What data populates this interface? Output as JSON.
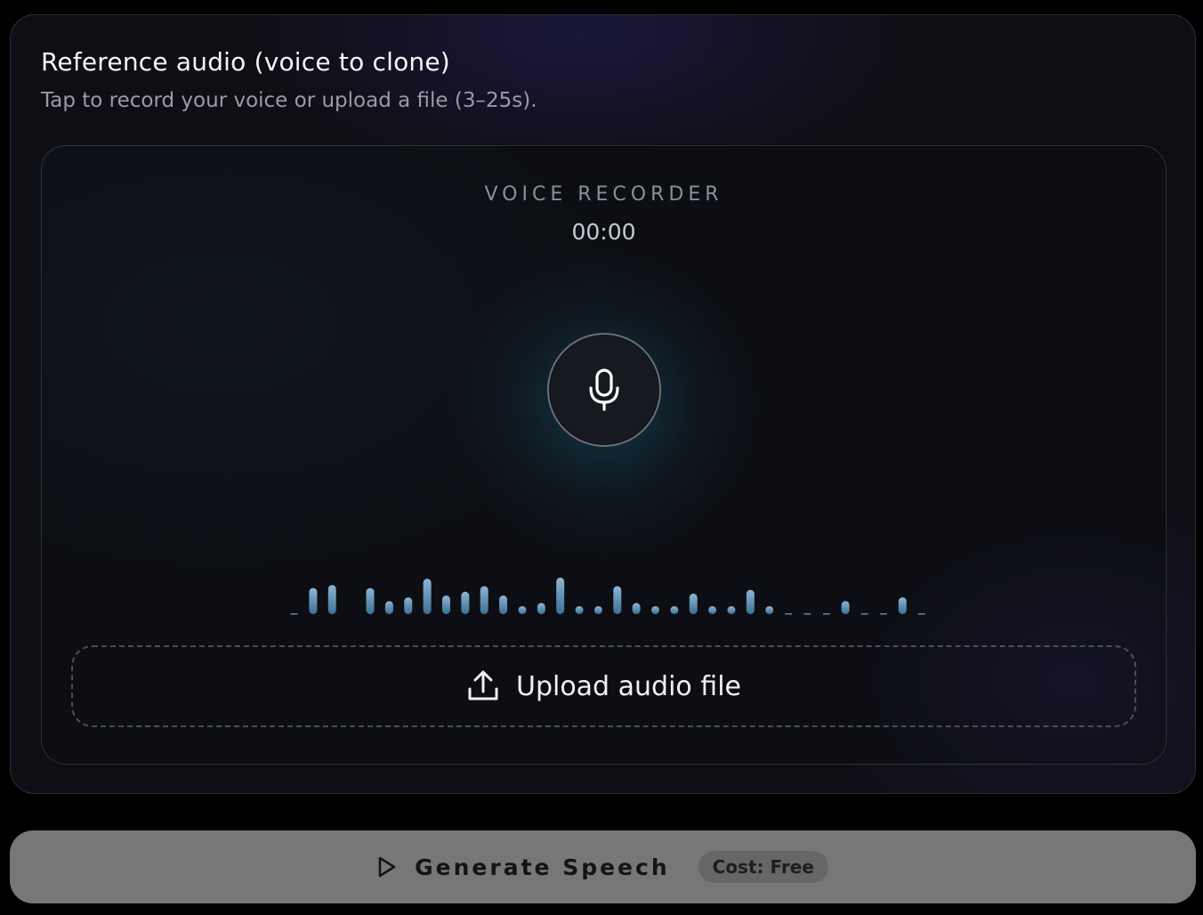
{
  "reference": {
    "title": "Reference audio (voice to clone)",
    "subtitle": "Tap to record your voice or upload a file (3–25s)."
  },
  "recorder": {
    "label": "VOICE RECORDER",
    "time": "00:00",
    "mic_icon": "microphone-icon",
    "waveform_levels": [
      0.05,
      0.7,
      0.78,
      0,
      0.7,
      0.35,
      0.45,
      0.95,
      0.5,
      0.6,
      0.75,
      0.5,
      0.18,
      0.3,
      0.98,
      0.2,
      0.2,
      0.75,
      0.3,
      0.1,
      0.12,
      0.55,
      0.12,
      0.12,
      0.65,
      0.07,
      0.03,
      0.03,
      0.03,
      0.35,
      0.03,
      0.03,
      0.45,
      0.03
    ]
  },
  "upload": {
    "label": "Upload audio file",
    "icon": "upload-icon"
  },
  "generate": {
    "label": "Generate Speech",
    "icon": "play-icon",
    "cost": "Cost: Free"
  },
  "colors": {
    "waveform_top": "#8fb4d4",
    "waveform_bottom": "#3a6f96",
    "generate_bg": "#777777"
  }
}
